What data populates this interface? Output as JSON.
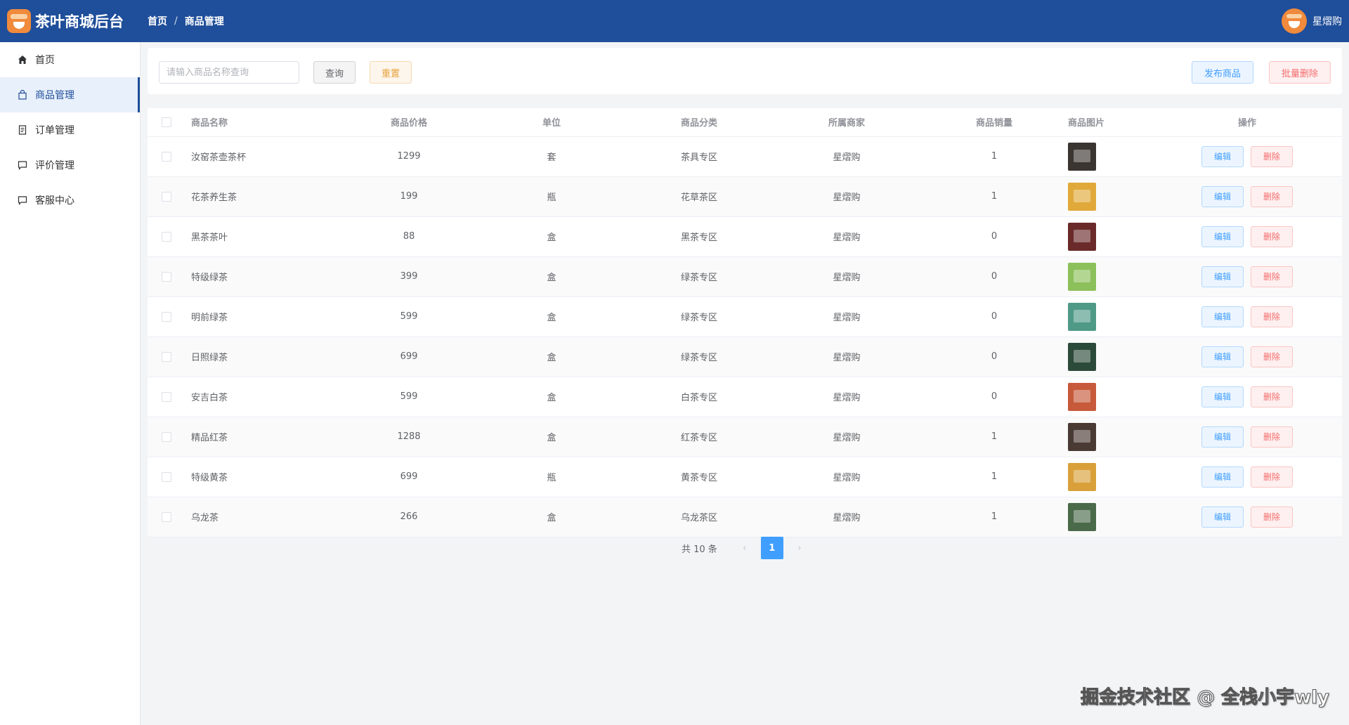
{
  "header": {
    "app_title": "茶叶商城后台",
    "breadcrumb": [
      "首页",
      "商品管理"
    ],
    "breadcrumb_sep": "/",
    "user_name": "星熠购"
  },
  "sidebar": {
    "items": [
      {
        "label": "首页",
        "icon": "home-icon",
        "active": false
      },
      {
        "label": "商品管理",
        "icon": "bag-icon",
        "active": true
      },
      {
        "label": "订单管理",
        "icon": "document-icon",
        "active": false
      },
      {
        "label": "评价管理",
        "icon": "chat-icon",
        "active": false
      },
      {
        "label": "客服中心",
        "icon": "chat-icon",
        "active": false
      }
    ]
  },
  "toolbar": {
    "search_placeholder": "请输入商品名称查询",
    "query_label": "查询",
    "reset_label": "重置",
    "publish_label": "发布商品",
    "batch_delete_label": "批量删除"
  },
  "table": {
    "columns": [
      "商品名称",
      "商品价格",
      "单位",
      "商品分类",
      "所属商家",
      "商品销量",
      "商品图片",
      "操作"
    ],
    "edit_label": "编辑",
    "delete_label": "删除",
    "rows": [
      {
        "name": "汝窑茶壶茶杯",
        "price": "1299",
        "unit": "套",
        "category": "茶具专区",
        "merchant": "星熠购",
        "sales": "1",
        "thumb_color": "#3b3531"
      },
      {
        "name": "花茶养生茶",
        "price": "199",
        "unit": "瓶",
        "category": "花草茶区",
        "merchant": "星熠购",
        "sales": "1",
        "thumb_color": "#e0a93a"
      },
      {
        "name": "黑茶茶叶",
        "price": "88",
        "unit": "盒",
        "category": "黑茶专区",
        "merchant": "星熠购",
        "sales": "0",
        "thumb_color": "#6b2a2a"
      },
      {
        "name": "特级绿茶",
        "price": "399",
        "unit": "盒",
        "category": "绿茶专区",
        "merchant": "星熠购",
        "sales": "0",
        "thumb_color": "#8cc05a"
      },
      {
        "name": "明前绿茶",
        "price": "599",
        "unit": "盒",
        "category": "绿茶专区",
        "merchant": "星熠购",
        "sales": "0",
        "thumb_color": "#4f9a86"
      },
      {
        "name": "日照绿茶",
        "price": "699",
        "unit": "盒",
        "category": "绿茶专区",
        "merchant": "星熠购",
        "sales": "0",
        "thumb_color": "#2c4a3a"
      },
      {
        "name": "安吉白茶",
        "price": "599",
        "unit": "盒",
        "category": "白茶专区",
        "merchant": "星熠购",
        "sales": "0",
        "thumb_color": "#c75a3a"
      },
      {
        "name": "精品红茶",
        "price": "1288",
        "unit": "盒",
        "category": "红茶专区",
        "merchant": "星熠购",
        "sales": "1",
        "thumb_color": "#4a3a34"
      },
      {
        "name": "特级黄茶",
        "price": "699",
        "unit": "瓶",
        "category": "黄茶专区",
        "merchant": "星熠购",
        "sales": "1",
        "thumb_color": "#d9a03a"
      },
      {
        "name": "乌龙茶",
        "price": "266",
        "unit": "盒",
        "category": "乌龙茶区",
        "merchant": "星熠购",
        "sales": "1",
        "thumb_color": "#4a6a4a"
      }
    ]
  },
  "pagination": {
    "total_text": "共 10 条",
    "current_page": "1",
    "prev_symbol": "‹",
    "next_symbol": "›"
  },
  "watermark": "掘金技术社区 @ 全栈小宇wly"
}
